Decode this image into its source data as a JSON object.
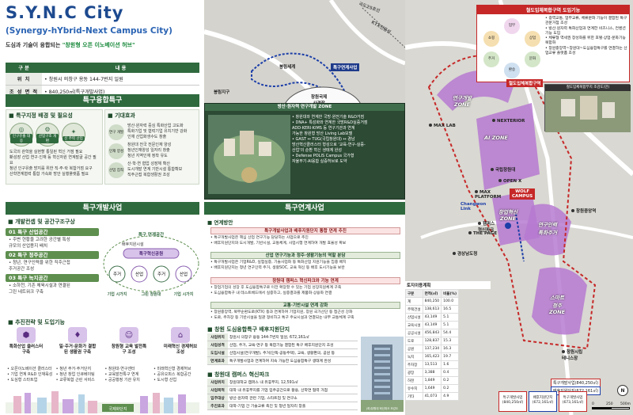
{
  "header": {
    "title": "S.Y.N.C City",
    "subtitle": "(Synergy-hYbrid-Next Campus City)",
    "slogan_lead": "도심과 기술이 융합되는",
    "slogan_quote": "\"창원형 오픈 이노베이션 허브\""
  },
  "info_table": {
    "head_key": "구 분",
    "head_val": "내 용",
    "rows": [
      {
        "k": "위 치",
        "v": "• 창원시 의창구 용동 144-7번지 일원"
      },
      {
        "k": "조 성 면 적",
        "v": "• 840,250㎡(특구개발사업)"
      }
    ]
  },
  "special_zone": {
    "heading": "특구융합특구",
    "bg_title": "특구지정 배경 및 필요성",
    "bg_circles": [
      {
        "icon": "◎",
        "label": "인구유출 대응"
      },
      {
        "icon": "⚙",
        "label": "산업구조 개편"
      },
      {
        "icon": "✦",
        "label": "신 주력 산업"
      }
    ],
    "bg_bullets": [
      "도국의 관학을 실현할 통일된 혁신 거점 필요",
      "新성장 산업 연구·인재 등 혁신자원 연계발굴 공간 필요",
      "청년 인구유출 방지를 위한 직·주·락 복합거점 요구",
      "산학연계협력 통합 가속화 방안 실행플랫폼 필요"
    ],
    "exp_title": "기대효과",
    "expectations": [
      {
        "circ": "연구 개발",
        "lines": [
          "방산·원자력 중심 특화산업 고도화",
          "특화기업 및 협력기업 유치기반 강화",
          "인재 산업화생수도 창출"
        ]
      },
      {
        "circ": "인재 양성",
        "lines": [
          "창원대 전국 전문인재 양성",
          "청년인재양성 일자리 창출",
          "청년 지역인재 정착 유도"
        ]
      },
      {
        "circ": "산업 집적",
        "lines": [
          "산·학·연 협업 성장체 확산",
          "도시개발 연계 기반시설 통합확보",
          "직주근접 복합생활권 조성"
        ]
      }
    ]
  },
  "dev_project": {
    "heading": "특구개발사업",
    "plan_title": "개발컨셉 및 공간구조구상",
    "stages": [
      {
        "bar": "01 특구 산업공간",
        "text": [
          "• 주변 현황을 고려한 공간별 특성",
          "  규모의 산업용지 배치"
        ]
      },
      {
        "bar": "02 특구 정주공간",
        "text": [
          "• 청년, 연구인력을 위한 직주근접",
          "  주거공간 조성"
        ]
      },
      {
        "bar": "03 특구 녹지공간",
        "text": [
          "• 소하천, 기존 체육시설과 연결된",
          "  그린 네트워크 구축"
        ]
      }
    ],
    "diagram_labels": {
      "network": "특구 연계공간",
      "zone": "특구혁신공원",
      "center": "배후지원시설",
      "nodes": [
        "주거",
        "산업",
        "주거",
        "산업"
      ],
      "bottoms": [
        "기업\n시가지",
        "그린\n창원대",
        "기업\n시가지"
      ]
    },
    "strategy_title": "추진전략 및 도입기능",
    "strategies": [
      {
        "icon": "⬢",
        "title": "특화산업\n클러스터 구축",
        "color": "#d8c3ea"
      },
      {
        "icon": "♦",
        "title": "일·주거·문화가\n결합된 생활권 구축",
        "color": "#d8c3ea"
      },
      {
        "icon": "☺",
        "title": "창원형 교육\n발전특구 조성",
        "color": "#d8c3ea"
      },
      {
        "icon": "⌂",
        "title": "미래혁신\n경제허브 조성",
        "color": "#d8c3ea"
      }
    ],
    "strategy_details": [
      [
        "• 오픈이노베이션 클러스터",
        "• 기업 연계 R&D 인재육성",
        "• 도심형 스타트업"
      ],
      [
        "• 청년 주거·주거단지",
        "• 청년 창업 인큐베이팅",
        "• 교류복합 근린 서비스"
      ],
      [
        "• 창원대·연구센터",
        "• 교육발전특구 연계",
        "• 공공행정 기관 유치"
      ],
      [
        "• 미래혁신형 경제허브",
        "• 공유오피스 복합공간",
        "• 도시형 산업"
      ]
    ],
    "graph_caption": "국제화단지"
  },
  "center_map": {
    "labels": {
      "campus_yard": "봉림세계",
      "hub": "봉림지구",
      "intl": "창원국제\n사격장",
      "spec": "특구연계사업",
      "road1": "KTX전용선",
      "road2": "국도25호선"
    }
  },
  "hybrid_panel": {
    "header": "방산·원자력 연구개발 ZONE",
    "bullets": [
      "• 창원대와 연계한 국방·원전기술 R&D거점",
      "• DNA+ 특성화와 연계한 국방R&D실증거점",
      "  ADD·KERI·KIMS 등 연구기관과 연계",
      "  가능한 창원형 방산 Living Lab모델",
      "• GAST ↔ TUG(국립창원대) ↔ 경남",
      "  방산혁신클러스터 형성으로 '교육-연구-실증-",
      "  산업'의 순환 혁신 생태계 완성",
      "• Defense POLIS Campus 국가형",
      "  자율무기·AI융합 실증허브로 도약"
    ]
  },
  "link_project": {
    "heading": "특구연계사업",
    "plan": "연계방안",
    "items": [
      {
        "head": "특구개발사업과 배후지원단지 통합 연계 추진",
        "lines": [
          "• 특구개발사업은 핵심 산업 연구기능 담당하는 사업으로 추진",
          "• 배후지원단지와 도시개발, 기반시설, 교통체계, 사업시행 연계하여 개발 효율성 확보"
        ]
      },
      {
        "head": "산업 연구기능과 정주·생활기능의 역할 분담",
        "lines": [
          "• 특구개발사업은 기업R&D, 실험실증, 기술사업화 등 특화산업 지원기능을 집중 배치",
          "• 배후지원단지는 청년 연구인력 주거, 생활SOC, 교육 혁신 등 배후 도시기능을 보완"
        ]
      },
      {
        "head": "창원대 캠퍼스 혁신파크와 기능 연계",
        "lines": [
          "• 창업기업의 성장 후 도심융합특구로 이전 확장할 수 있는 기업 성장지원체계 구축",
          "• 도심융합특구 내 테스트베드에서 실증하고, 실증결과를 제품화·상용화 연결"
        ]
      },
      {
        "head": "교통·기반시설 연계 강화",
        "lines": [
          "• 창원중앙역, 북부순환도로(KTX) 등과 연계하여 기업지원, 창원 국가산단 등 접근성 강화",
          "• 도로, 주차장 등 기반시설을 일괄 정비하고 특구 주요시설과 연결되는 내부 교통체계 구축"
        ]
      }
    ]
  },
  "hub_site": {
    "title": "창원 도심융합특구 배후지원단지",
    "rows": [
      {
        "k": "사업위치",
        "v": "창원시 의창구 용동 144-7번지 일원, 672,161㎡"
      },
      {
        "k": "사업성격",
        "v": "산업, 주거, 교육·연구 등 복합기능 결합된 특구 배후지원단지 조성"
      },
      {
        "k": "도입시설",
        "v": "산업시설(연구개발), 주거(단독·공동주택), 교육, 생활편의, 공원 등"
      },
      {
        "k": "연계효과",
        "v": "특구개발사업과 연계하여 지속 가능한 도심융합특구 생태계 완성"
      }
    ]
  },
  "campus_park": {
    "title": "창원대 캠퍼스 혁신파크",
    "rows": [
      {
        "k": "사업위치",
        "v": "창원대학교 캠퍼스 내 유휴부지, 12,591㎡"
      },
      {
        "k": "사업목적",
        "v": "대학 내 유휴부지를 기업 입주공간으로 활용, 산학연 협력 거점"
      },
      {
        "k": "입주대상",
        "v": "방산·원자력 관련 기업, 스타트업 및 연구소"
      },
      {
        "k": "추진효과",
        "v": "대학-기업 간 기술교류 촉진 및 청년 일자리 창출"
      }
    ],
    "photo_caption": "(좌)창원대 혁신파크 조감도"
  },
  "right_map": {
    "function_box": {
      "title": "철도입체복합구역 도입기능",
      "icons": [
        "업무",
        "쇼핑",
        "상업",
        "주거",
        "문화",
        "환승"
      ],
      "bullets": [
        "• 광역교통, 업무교류, 체류문화 기능이 결합된 특구 관문거점 조성",
        "• 방산·원자력 특화산업과 연계한 비즈니스, 컨벤션 기능 도입",
        "• 체류형 역세권 창성화를 위한 호텔·상업·문화기능 복합화",
        "• 창원중앙역~창원대~도심융합특구를 연결하는 산업교류 플랫폼 조성"
      ]
    },
    "photo_caption": "철도입체복합부지 조감도(만)",
    "zones": {
      "research": "연구개발\nZONE",
      "ai": "AI ZONE",
      "startup": "창업혁신\nZONE",
      "wolf": "WOLF\nCAMPUS",
      "research2": "연구인력\n특화주거",
      "smart": "스마트\n정주\nZONE"
    },
    "places": [
      "MAX LAB",
      "NEXTERIOR",
      "국립창원대",
      "캠퍼스\n혁신파크",
      "경상남도청",
      "창원중앙역",
      "창원시립\n테니스장",
      "OPEN X",
      "MAX\nPLATFORM",
      "THE PAGE",
      "Changwon\nLink"
    ],
    "tag_rail": "철도입체복합구역",
    "tag_smart": "특구연계사업",
    "landuse": {
      "title": "토지이용계획",
      "header": [
        "구분",
        "면적(㎡)",
        "비율(%)"
      ],
      "rows": [
        [
          "계",
          "840,250",
          "100.0"
        ],
        [
          "주택건설",
          "138,613",
          "16.5"
        ],
        [
          "산업시설",
          "43,149",
          "5.1"
        ],
        [
          "교육시설",
          "43,149",
          "5.1"
        ],
        [
          "공공시설",
          "456,843",
          "54.4"
        ],
        [
          "도로",
          "128,837",
          "15.3"
        ],
        [
          "공원",
          "137,234",
          "16.3"
        ],
        [
          "녹지",
          "165,423",
          "19.7"
        ],
        [
          "주차장",
          "13,513",
          "1.6"
        ],
        [
          "광장",
          "3,388",
          "0.4"
        ],
        [
          "하천",
          "1,849",
          "0.2"
        ],
        [
          "유수지",
          "1,649",
          "0.2"
        ],
        [
          "기타",
          "41,073",
          "4.9"
        ]
      ]
    },
    "boundary_caption": "특구개발사업(840,250㎡)",
    "boundary_caption2": "배후지원단지(672,161㎡)",
    "legend_blocks": [
      "특구개발사업\n(840,250㎡)",
      "배후지원단지\n(672,161㎡)",
      "특구개발사업\n(673,161㎡)"
    ],
    "scale_0": "0",
    "scale_mid": "250",
    "scale_end": "500m"
  },
  "colors": {
    "primary_green": "#2f6a3e",
    "title_blue": "#1d4a8f",
    "accent_red": "#c62828",
    "zone_purple": "#b67ad1"
  }
}
